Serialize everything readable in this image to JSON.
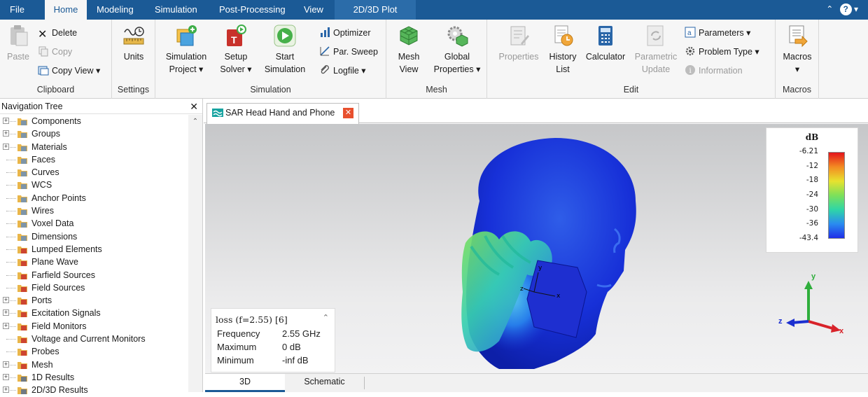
{
  "menu": {
    "tabs": [
      "File",
      "Home",
      "Modeling",
      "Simulation",
      "Post-Processing",
      "View",
      "2D/3D Plot"
    ],
    "active": "Home",
    "help": "?"
  },
  "ribbon": {
    "clipboard": {
      "label": "Clipboard",
      "paste": "Paste",
      "delete": "Delete",
      "copy": "Copy",
      "copy_view": "Copy View ▾"
    },
    "settings": {
      "label": "Settings",
      "units": "Units"
    },
    "simulation": {
      "label": "Simulation",
      "sim_project_1": "Simulation",
      "sim_project_2": "Project ▾",
      "setup_1": "Setup",
      "setup_2": "Solver ▾",
      "start_1": "Start",
      "start_2": "Simulation",
      "optimizer": "Optimizer",
      "par_sweep": "Par. Sweep",
      "logfile": "Logfile ▾"
    },
    "mesh": {
      "label": "Mesh",
      "mesh_view_1": "Mesh",
      "mesh_view_2": "View",
      "global_1": "Global",
      "global_2": "Properties ▾"
    },
    "edit": {
      "label": "Edit",
      "properties": "Properties",
      "history_1": "History",
      "history_2": "List",
      "calculator": "Calculator",
      "param_update_1": "Parametric",
      "param_update_2": "Update",
      "parameters": "Parameters ▾",
      "problem_type": "Problem Type ▾",
      "information": "Information"
    },
    "macros": {
      "label": "Macros",
      "macros_1": "Macros",
      "macros_2": "▾"
    }
  },
  "nav": {
    "title": "Navigation Tree",
    "close": "✕",
    "items": [
      {
        "label": "Components",
        "expandable": true,
        "icon": "folder"
      },
      {
        "label": "Groups",
        "expandable": true,
        "icon": "folder"
      },
      {
        "label": "Materials",
        "expandable": true,
        "icon": "folder"
      },
      {
        "label": "Faces",
        "expandable": false,
        "icon": "folder"
      },
      {
        "label": "Curves",
        "expandable": false,
        "icon": "folder"
      },
      {
        "label": "WCS",
        "expandable": false,
        "icon": "folder"
      },
      {
        "label": "Anchor Points",
        "expandable": false,
        "icon": "folder"
      },
      {
        "label": "Wires",
        "expandable": false,
        "icon": "folder"
      },
      {
        "label": "Voxel Data",
        "expandable": false,
        "icon": "folder"
      },
      {
        "label": "Dimensions",
        "expandable": false,
        "icon": "folder"
      },
      {
        "label": "Lumped Elements",
        "expandable": false,
        "icon": "source-folder"
      },
      {
        "label": "Plane Wave",
        "expandable": false,
        "icon": "source-folder"
      },
      {
        "label": "Farfield Sources",
        "expandable": false,
        "icon": "source-folder"
      },
      {
        "label": "Field Sources",
        "expandable": false,
        "icon": "source-folder"
      },
      {
        "label": "Ports",
        "expandable": true,
        "icon": "source-folder"
      },
      {
        "label": "Excitation Signals",
        "expandable": true,
        "icon": "source-folder"
      },
      {
        "label": "Field Monitors",
        "expandable": true,
        "icon": "source-folder"
      },
      {
        "label": "Voltage and Current Monitors",
        "expandable": false,
        "icon": "source-folder"
      },
      {
        "label": "Probes",
        "expandable": false,
        "icon": "source-folder"
      },
      {
        "label": "Mesh",
        "expandable": true,
        "icon": "source-folder"
      },
      {
        "label": "1D Results",
        "expandable": true,
        "icon": "result-folder"
      },
      {
        "label": "2D/3D Results",
        "expandable": true,
        "icon": "result-folder"
      }
    ]
  },
  "document": {
    "tab_title": "SAR Head Hand and Phone"
  },
  "legend": {
    "unit": "dB",
    "ticks": [
      "-6.21",
      "-12",
      "-18",
      "-24",
      "-30",
      "-36",
      "-43.4"
    ]
  },
  "info": {
    "title": "loss (f=2.55) [6]",
    "rows": [
      {
        "label": "Frequency",
        "value": "2.55 GHz"
      },
      {
        "label": "Maximum",
        "value": "0 dB"
      },
      {
        "label": "Minimum",
        "value": "-inf dB"
      }
    ]
  },
  "axes": {
    "x": "x",
    "y": "y",
    "z": "z"
  },
  "view_tabs": [
    "3D",
    "Schematic"
  ],
  "colors": {
    "accent": "#1b5a96",
    "close": "#e8502e"
  }
}
